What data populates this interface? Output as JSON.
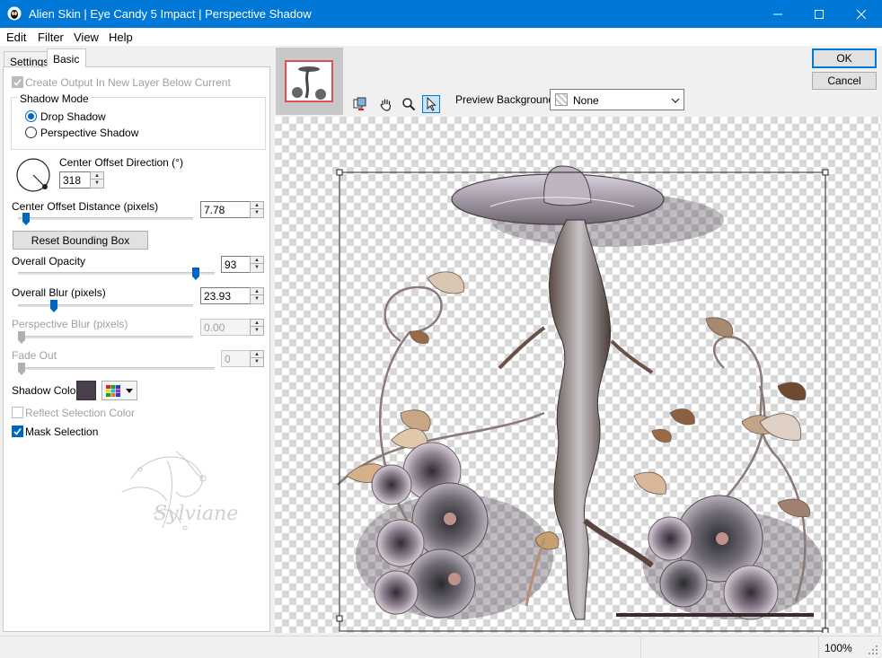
{
  "window": {
    "title": "Alien Skin | Eye Candy 5 Impact | Perspective Shadow",
    "minimize_glyph": "—",
    "maximize_glyph": "☐",
    "close_glyph": "✕"
  },
  "menu": {
    "edit": "Edit",
    "filter": "Filter",
    "view": "View",
    "help": "Help"
  },
  "tabs": {
    "settings": "Settings",
    "basic": "Basic"
  },
  "basic": {
    "create_output_label": "Create Output In New Layer Below Current",
    "create_output_checked": true,
    "shadow_mode_title": "Shadow Mode",
    "drop_shadow_label": "Drop Shadow",
    "perspective_shadow_label": "Perspective Shadow",
    "shadow_mode_selected": "Drop Shadow",
    "center_offset_direction_label": "Center Offset Direction (°)",
    "center_offset_direction_value": "318",
    "center_offset_distance_label": "Center Offset Distance (pixels)",
    "center_offset_distance_value": "7.78",
    "reset_bounding_box_label": "Reset Bounding Box",
    "overall_opacity_label": "Overall Opacity",
    "overall_opacity_value": "93",
    "overall_blur_label": "Overall Blur (pixels)",
    "overall_blur_value": "23.93",
    "perspective_blur_label": "Perspective Blur (pixels)",
    "perspective_blur_value": "0.00",
    "fade_out_label": "Fade Out",
    "fade_out_value": "0",
    "shadow_color_label": "Shadow Color",
    "shadow_color": "#4a3f4e",
    "reflect_selection_color_label": "Reflect Selection Color",
    "mask_selection_label": "Mask Selection",
    "mask_selection_checked": true
  },
  "watermark": {
    "text": "Sylviane"
  },
  "buttons": {
    "ok": "OK",
    "cancel": "Cancel"
  },
  "preview": {
    "background_label": "Preview Background:",
    "background_value": "None"
  },
  "status": {
    "zoom": "100%"
  },
  "colors": {
    "titlebar": "#0078d7",
    "accent": "#0067c0"
  }
}
